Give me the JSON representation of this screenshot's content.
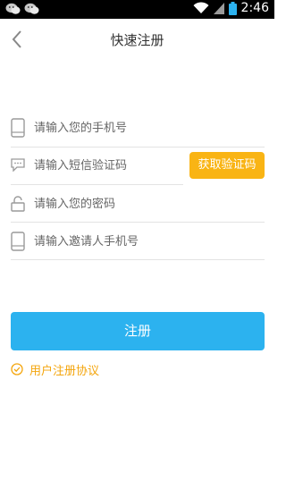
{
  "status_bar": {
    "time": "2:46",
    "icons": [
      "wechat-icon",
      "wechat-icon",
      "wifi-icon",
      "signal-icon",
      "battery-icon"
    ]
  },
  "header": {
    "title": "快速注册",
    "back_icon": "chevron-left-icon"
  },
  "form": {
    "phone": {
      "placeholder": "请输入您的手机号",
      "value": "",
      "icon": "phone-icon"
    },
    "sms_code": {
      "placeholder": "请输入短信验证码",
      "value": "",
      "icon": "message-icon"
    },
    "get_code_label": "获取验证码",
    "password": {
      "placeholder": "请输入您的密码",
      "value": "",
      "icon": "lock-icon"
    },
    "inviter_phone": {
      "placeholder": "请输入邀请人手机号",
      "value": "",
      "icon": "phone-icon"
    }
  },
  "register_label": "注册",
  "agreement": {
    "label": "用户注册协议",
    "icon": "check-circle-icon"
  },
  "colors": {
    "primary": "#2cb2ef",
    "accent": "#f9b414",
    "agreement": "#f4a50c",
    "divider": "#e3e3e3",
    "icon": "#9a9a9a"
  }
}
